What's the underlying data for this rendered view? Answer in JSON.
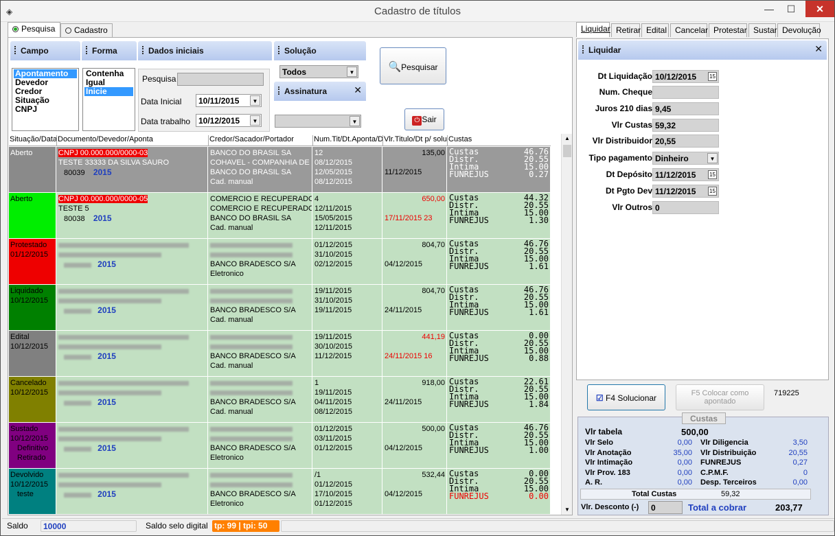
{
  "window": {
    "title": "Cadastro de títulos"
  },
  "left_tabs": [
    "Pesquisa",
    "Cadastro"
  ],
  "filters": {
    "campo_label": "Campo",
    "campo_items": [
      "Apontamento",
      "Devedor",
      "Credor",
      "Situação",
      "CNPJ"
    ],
    "forma_label": "Forma",
    "forma_items": [
      "Contenha",
      "Igual",
      "Inicie"
    ],
    "dados_label": "Dados iniciais",
    "pesquisa_label": "Pesquisa",
    "data_inicial_label": "Data Inicial",
    "data_inicial_value": "10/11/2015",
    "data_trabalho_label": "Data trabalho",
    "data_trabalho_value": "10/12/2015",
    "solucao_label": "Solução",
    "solucao_value": "Todos",
    "assinatura_label": "Assinatura",
    "pesquisar_button": "Pesquisar",
    "sair_button": "Sair"
  },
  "grid": {
    "headers": [
      "Situação/Data",
      "Documento/Devedor/Aponta",
      "Credor/Sacador/Portador",
      "Num.Tit/Dt.Aponta/Dt",
      "Vlr.Titulo/Dt p/ solu",
      "Custas"
    ],
    "rows": [
      {
        "status": "Aberto",
        "date": "",
        "extra": [
          "",
          ""
        ],
        "color": "#8a8a8a",
        "bg": "#9a9a9a",
        "doc1": "CNPJ 00.000.000/0000-03",
        "doc2": "TESTE 33333 DA SILVA SAURO",
        "doc_num": "80039",
        "year": "2015",
        "cred": [
          "BANCO DO BRASIL SA",
          "COHAVEL - COMPANHIA DE HA",
          "BANCO DO BRASIL SA",
          "Cad. manual"
        ],
        "num": [
          "12",
          "08/12/2015",
          "12/05/2015",
          "08/12/2015"
        ],
        "val": "135,00",
        "val_red": false,
        "dtsol": "11/12/2015",
        "dtsol_red": false,
        "costs": [
          [
            "Custas",
            "46.76"
          ],
          [
            "Distr.",
            "20.55"
          ],
          [
            "Intima",
            "15.00"
          ],
          [
            "FUNREJUS",
            "0.27"
          ]
        ],
        "costs_style": "gray"
      },
      {
        "status": "Aberto",
        "date": "",
        "extra": [
          "",
          ""
        ],
        "color": "#00ee00",
        "bg": "#c2e0c2",
        "doc1": "CNPJ 00.000.000/0000-05",
        "doc2": "TESTE 5",
        "doc_num": "80038",
        "year": "2015",
        "cred": [
          "COMERCIO E RECUPERADORA",
          "COMERCIO E RECUPERADORA",
          "BANCO DO BRASIL SA",
          "Cad. manual"
        ],
        "num": [
          "4",
          "12/11/2015",
          "15/05/2015",
          "12/11/2015"
        ],
        "val": "650,00",
        "val_red": true,
        "dtsol": "17/11/2015  23",
        "dtsol_red": true,
        "costs": [
          [
            "Custas",
            "44.32"
          ],
          [
            "Distr.",
            "20.55"
          ],
          [
            "Intima",
            "15.00"
          ],
          [
            "FUNREJUS",
            "1.30"
          ]
        ],
        "costs_style": "normal"
      },
      {
        "status": "Protestado",
        "date": "01/12/2015",
        "extra": [
          "",
          ""
        ],
        "color": "#ee0000",
        "bg": "#c2e0c2",
        "doc1": "",
        "doc2": "",
        "doc_num": "",
        "year": "2015",
        "cred": [
          "",
          "",
          "BANCO BRADESCO S/A",
          "Eletronico"
        ],
        "num": [
          "",
          "01/12/2015",
          "31/10/2015",
          "02/12/2015"
        ],
        "val": "804,70",
        "val_red": false,
        "dtsol": "04/12/2015",
        "dtsol_red": false,
        "costs": [
          [
            "Custas",
            "46.76"
          ],
          [
            "Distr.",
            "20.55"
          ],
          [
            "Intima",
            "15.00"
          ],
          [
            "FUNREJUS",
            "1.61"
          ]
        ],
        "costs_style": "normal"
      },
      {
        "status": "Liquidado",
        "date": "10/12/2015",
        "extra": [
          "",
          ""
        ],
        "color": "#008000",
        "bg": "#c2e0c2",
        "doc1": "",
        "doc2": "",
        "doc_num": "",
        "year": "2015",
        "cred": [
          "",
          "",
          "BANCO BRADESCO S/A",
          "Cad. manual"
        ],
        "num": [
          "",
          "19/11/2015",
          "31/10/2015",
          "19/11/2015"
        ],
        "val": "804,70",
        "val_red": false,
        "dtsol": "24/11/2015",
        "dtsol_red": false,
        "costs": [
          [
            "Custas",
            "46.76"
          ],
          [
            "Distr.",
            "20.55"
          ],
          [
            "Intima",
            "15.00"
          ],
          [
            "FUNREJUS",
            "1.61"
          ]
        ],
        "costs_style": "normal"
      },
      {
        "status": "Edital",
        "date": "10/12/2015",
        "extra": [
          "",
          ""
        ],
        "color": "#808080",
        "bg": "#c2e0c2",
        "doc1": "",
        "doc2": "",
        "doc_num": "",
        "year": "2015",
        "cred": [
          "",
          "",
          "BANCO BRADESCO S/A",
          "Cad. manual"
        ],
        "num": [
          "",
          "19/11/2015",
          "30/10/2015",
          "11/12/2015"
        ],
        "val": "441,19",
        "val_red": true,
        "dtsol": "24/11/2015  16",
        "dtsol_red": true,
        "costs": [
          [
            "Custas",
            "0.00"
          ],
          [
            "Distr.",
            "20.55"
          ],
          [
            "Intima",
            "15.00"
          ],
          [
            "FUNREJUS",
            "0.88"
          ]
        ],
        "costs_style": "normal"
      },
      {
        "status": "Cancelado",
        "date": "10/12/2015",
        "extra": [
          "",
          ""
        ],
        "color": "#808000",
        "bg": "#c2e0c2",
        "doc1": "",
        "doc2": "",
        "doc_num": "",
        "year": "2015",
        "cred": [
          "",
          "",
          "BANCO BRADESCO S/A",
          "Cad. manual"
        ],
        "num": [
          "1",
          "19/11/2015",
          "04/11/2015",
          "08/12/2015"
        ],
        "val": "918,00",
        "val_red": false,
        "dtsol": "24/11/2015",
        "dtsol_red": false,
        "costs": [
          [
            "Custas",
            "22.61"
          ],
          [
            "Distr.",
            "20.55"
          ],
          [
            "Intima",
            "15.00"
          ],
          [
            "FUNREJUS",
            "1.84"
          ]
        ],
        "costs_style": "normal"
      },
      {
        "status": "Sustado",
        "date": "10/12/2015",
        "extra": [
          "Definitivo",
          "Retirado"
        ],
        "color": "#800080",
        "bg": "#c2e0c2",
        "doc1": "",
        "doc2": "",
        "doc_num": "",
        "year": "2015",
        "cred": [
          "",
          "",
          "BANCO BRADESCO S/A",
          "Eletronico"
        ],
        "num": [
          "",
          "01/12/2015",
          "03/11/2015",
          "01/12/2015"
        ],
        "val": "500,00",
        "val_red": false,
        "dtsol": "04/12/2015",
        "dtsol_red": false,
        "costs": [
          [
            "Custas",
            "46.76"
          ],
          [
            "Distr.",
            "20.55"
          ],
          [
            "Intima",
            "15.00"
          ],
          [
            "FUNREJUS",
            "1.00"
          ]
        ],
        "costs_style": "normal"
      },
      {
        "status": "Devolvido",
        "date": "10/12/2015",
        "extra": [
          "teste",
          ""
        ],
        "color": "#008080",
        "bg": "#c2e0c2",
        "doc1": "",
        "doc2": "",
        "doc_num": "",
        "year": "2015",
        "cred": [
          "",
          "",
          "BANCO BRADESCO S/A",
          "Eletronico"
        ],
        "num": [
          "/1",
          "01/12/2015",
          "17/10/2015",
          "01/12/2015"
        ],
        "val": "532,44",
        "val_red": false,
        "dtsol": "04/12/2015",
        "dtsol_red": false,
        "costs": [
          [
            "Custas",
            "0.00"
          ],
          [
            "Distr.",
            "20.55"
          ],
          [
            "Intima",
            "15.00"
          ],
          [
            "FUNREJUS",
            "0.00"
          ]
        ],
        "costs_style": "redlast"
      }
    ]
  },
  "status_bar": {
    "saldo_label": "Saldo",
    "saldo_value": "10000",
    "selo_label": "Saldo selo digital",
    "selo_value": "tp: 99 | tpi: 50"
  },
  "right_tabs": [
    "Liquidar",
    "Retirar",
    "Edital",
    "Cancelar",
    "Protestar",
    "Sustar",
    "Devolução"
  ],
  "liquidar": {
    "header": "Liquidar",
    "fields": [
      {
        "label": "Dt Liquidação",
        "value": "10/12/2015",
        "cal": true
      },
      {
        "label": "Num. Cheque",
        "value": "",
        "cal": false
      },
      {
        "label": "Juros 210 dias",
        "value": "9,45",
        "cal": false
      },
      {
        "label": "Vlr Custas",
        "value": "59,32",
        "cal": false
      },
      {
        "label": "Vlr Distribuidor",
        "value": "20,55",
        "cal": false
      },
      {
        "label": "Tipo pagamento",
        "value": "Dinheiro",
        "cal": false,
        "dropdown": true
      },
      {
        "label": "Dt Depósito",
        "value": "11/12/2015",
        "cal": true
      },
      {
        "label": "Dt Pgto Dev",
        "value": "11/12/2015",
        "cal": true
      },
      {
        "label": "Vlr Outros",
        "value": "0",
        "cal": false
      }
    ],
    "solucionar_button": "F4 Solucionar",
    "apontado_button": "F5  Colocar como apontado",
    "code": "719225"
  },
  "costs": {
    "title": "Custas",
    "vlr_tabela_label": "Vlr tabela",
    "vlr_tabela": "500,00",
    "left": [
      [
        "Vlr Selo",
        "0,00"
      ],
      [
        "Vlr Anotação",
        "35,00"
      ],
      [
        "Vlr Intimação",
        "0,00"
      ],
      [
        "Vlr Prov. 183",
        "0,00"
      ],
      [
        "A. R.",
        "0,00"
      ]
    ],
    "right": [
      [
        "Vlr Diligencia",
        "3,50"
      ],
      [
        "Vlr Distribuição",
        "20,55"
      ],
      [
        "FUNREJUS",
        "0,27"
      ],
      [
        "C.P.M.F.",
        "0"
      ],
      [
        "Desp. Terceiros",
        "0,00"
      ]
    ],
    "total_label": "Total Custas",
    "total": "59,32",
    "desconto_label": "Vlr. Desconto (-)",
    "desconto": "0",
    "cobrar_label": "Total a cobrar",
    "cobrar": "203,77"
  }
}
